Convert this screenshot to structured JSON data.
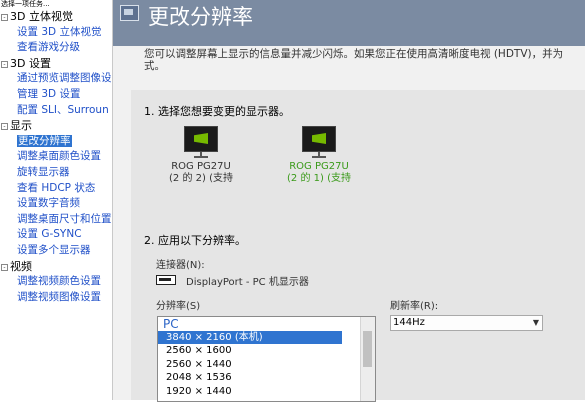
{
  "tree": {
    "task_header": "选择一项任务...",
    "categories": [
      {
        "label": "3D 立体视觉",
        "toggle": "-",
        "items": [
          {
            "label": "设置 3D 立体视觉",
            "selected": false
          },
          {
            "label": "查看游戏分级",
            "selected": false
          }
        ]
      },
      {
        "label": "3D 设置",
        "toggle": "-",
        "items": [
          {
            "label": "通过预览调整图像设",
            "selected": false
          },
          {
            "label": "管理 3D 设置",
            "selected": false
          },
          {
            "label": "配置 SLI、Surroun",
            "selected": false
          }
        ]
      },
      {
        "label": "显示",
        "toggle": "-",
        "items": [
          {
            "label": "更改分辨率",
            "selected": true
          },
          {
            "label": "调整桌面颜色设置",
            "selected": false
          },
          {
            "label": "旋转显示器",
            "selected": false
          },
          {
            "label": "查看 HDCP 状态",
            "selected": false
          },
          {
            "label": "设置数字音频",
            "selected": false
          },
          {
            "label": "调整桌面尺寸和位置",
            "selected": false
          },
          {
            "label": "设置 G-SYNC",
            "selected": false
          },
          {
            "label": "设置多个显示器",
            "selected": false
          }
        ]
      },
      {
        "label": "视频",
        "toggle": "-",
        "items": [
          {
            "label": "调整视频颜色设置",
            "selected": false
          },
          {
            "label": "调整视频图像设置",
            "selected": false
          }
        ]
      }
    ]
  },
  "header": {
    "title": "更改分辨率",
    "icon": "display-settings-icon",
    "color": "#7b8ba2"
  },
  "description": {
    "line1": "您可以调整屏幕上显示的信息量并减少闪烁。如果您正在使用高清晰度电视 (HDTV)，并为",
    "line2": "式。"
  },
  "step1": {
    "label": "1. 选择您想要变更的显示器。",
    "monitors": [
      {
        "name": "ROG PG27U",
        "info": "(2 的 2) (支持",
        "color": "#333333"
      },
      {
        "name": "ROG PG27U",
        "info": "(2 的 1) (支持",
        "color": "#3a9a1a"
      }
    ]
  },
  "step2": {
    "label": "2. 应用以下分辨率。",
    "connector_label": "连接器(N):",
    "connector_value": "DisplayPort - PC 机显示器",
    "resolution_label": "分辨率(S)",
    "refresh_label": "刷新率(R):",
    "refresh_value": "144Hz",
    "resolution_group": "PC",
    "resolutions": [
      {
        "label": "3840 × 2160 (本机)",
        "selected": true
      },
      {
        "label": "2560 × 1600",
        "selected": false
      },
      {
        "label": "2560 × 1440",
        "selected": false
      },
      {
        "label": "2048 × 1536",
        "selected": false
      },
      {
        "label": "1920 × 1440",
        "selected": false
      }
    ]
  },
  "colors": {
    "selection": "#2f74d0",
    "link": "#2050c8",
    "nvidia_green": "#76b900"
  }
}
